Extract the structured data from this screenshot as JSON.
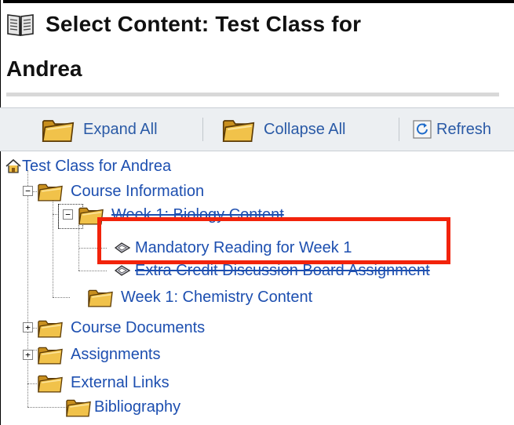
{
  "page": {
    "title_line1": "Select Content: Test Class for",
    "title_line2": "Andrea"
  },
  "toolbar": {
    "expand_all_label": "Expand All",
    "collapse_all_label": "Collapse All",
    "refresh_label": "Refresh"
  },
  "tree": {
    "root_label": "Test Class for Andrea",
    "items": [
      {
        "label": "Course Information",
        "expander": "−"
      },
      {
        "label": "Week 1: Biology Content",
        "expander": "−"
      },
      {
        "label": "Mandatory Reading for Week 1"
      },
      {
        "label": "Extra Credit Discussion Board Assignment"
      },
      {
        "label": "Week 1: Chemistry Content"
      },
      {
        "label": "Course Documents",
        "expander": "+"
      },
      {
        "label": "Assignments",
        "expander": "+"
      },
      {
        "label": "External Links"
      },
      {
        "label": "Bibliography"
      }
    ]
  },
  "colors": {
    "link": "#1d4fb0",
    "highlight": "#f2230b",
    "folder": "#e8b83a"
  },
  "icons": {
    "title": "open-book-icon",
    "expand": "folder-icon",
    "collapse": "folder-icon",
    "refresh": "refresh-icon",
    "root": "home-icon",
    "content_item": "diamond-item-icon"
  }
}
